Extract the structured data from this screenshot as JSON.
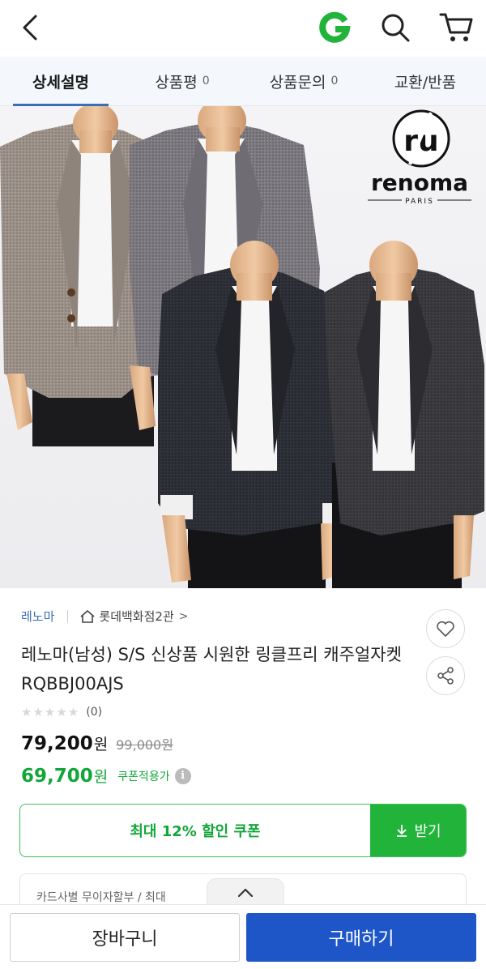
{
  "header": {
    "back_icon": "chevron-left-icon",
    "gmarket_icon": "g-logo-icon",
    "search_icon": "search-icon",
    "cart_icon": "cart-icon",
    "accent_green": "#12a63a"
  },
  "tabs": [
    {
      "label": "상세설명",
      "count": "",
      "active": true
    },
    {
      "label": "상품평",
      "count": "0",
      "active": false
    },
    {
      "label": "상품문의",
      "count": "0",
      "active": false
    },
    {
      "label": "교환/반품",
      "count": "",
      "active": false
    }
  ],
  "hero": {
    "logo_text": "renoma",
    "logo_sub": "PARIS",
    "logo_mark": "r/u"
  },
  "product": {
    "brand": "레노마",
    "store": "롯데백화점2관",
    "store_chevron": ">",
    "title": "레노마(남성) S/S 신상품 시원한 링클프리 캐주얼자켓RQBBJ00AJS",
    "stars": "★★★★★",
    "rating_count": "(0)",
    "price": "79,200",
    "price_unit": "원",
    "original_price": "99,000원",
    "coupon_price": "69,700",
    "coupon_unit": "원",
    "coupon_label": "쿠폰적용가",
    "info_mark": "i"
  },
  "coupon": {
    "text": "최대 12% 할인 쿠폰",
    "button": "받기"
  },
  "card_installment": "카드사별 무이자할부 / 최대",
  "bottom": {
    "cart_button": "장바구니",
    "buy_button": "구매하기",
    "buy_color": "#1e56c8"
  }
}
